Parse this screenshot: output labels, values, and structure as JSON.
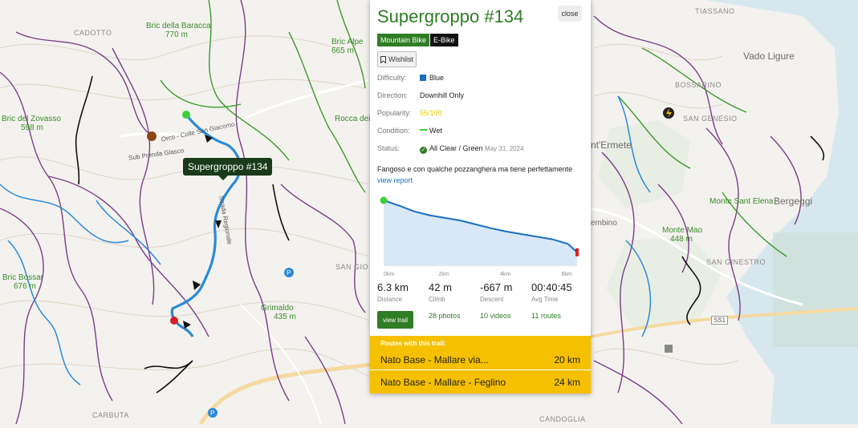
{
  "map": {
    "peaks": [
      {
        "name": "Bric della Baracca",
        "elev": "770 m"
      },
      {
        "name": "Bric Alpe",
        "elev": "665 m"
      },
      {
        "name": "Bric del Zovasso",
        "elev": "598 m"
      },
      {
        "name": "Rocca dei",
        "elev": ""
      },
      {
        "name": "Bric Bossar",
        "elev": "676 m"
      },
      {
        "name": "Grimaldo",
        "elev": "435 m"
      },
      {
        "name": "Monte Sant Elena",
        "elev": ""
      },
      {
        "name": "Monte Mao",
        "elev": "448 m"
      }
    ],
    "towns": [
      "CADOTTO",
      "TIASSANO",
      "BOSSARINO",
      "SAN GENESIO",
      "SAN GIO",
      "CARBUTA",
      "CANDOGLIA",
      "SAN GINESTRO"
    ],
    "cities": [
      "Vado Ligure",
      "Bergeggi",
      "nt'Ermete",
      "embino"
    ],
    "roads": [
      "SS1",
      "Orco - Colle San Giacomo",
      "Strada Regionale",
      "Sub Prenda Glasco"
    ],
    "tooltip": "Supergroppo #134"
  },
  "panel": {
    "title": "Supergroppo #134",
    "close_label": "close",
    "tags": [
      "Mountain Bike",
      "E-Bike"
    ],
    "wishlist_label": "Wishlist",
    "rows": [
      {
        "label": "Difficulty:",
        "value": "Blue"
      },
      {
        "label": "Direction:",
        "value": "Downhill Only"
      },
      {
        "label": "Popularity:",
        "value": "55/100"
      },
      {
        "label": "Condition:",
        "value": "Wet"
      },
      {
        "label": "Status:",
        "value": "All Clear / Green",
        "date": "May 31, 2024"
      }
    ],
    "description": "Fangoso e con qualche pozzanghera ma tiene perfettamente",
    "view_report": "view report",
    "chart_data": {
      "type": "area",
      "x_ticks": [
        "0km",
        "2km",
        "4km",
        "6km"
      ],
      "x": [
        0,
        0.5,
        1,
        1.5,
        2,
        2.5,
        3,
        3.5,
        4,
        4.5,
        5,
        5.5,
        6,
        6.3
      ],
      "y": [
        100,
        92,
        83,
        77,
        73,
        69,
        63,
        57,
        52,
        48,
        44,
        40,
        33,
        20
      ],
      "ylabel": "",
      "xlabel": ""
    },
    "stats": [
      {
        "value": "6.3 km",
        "label": "Distance"
      },
      {
        "value": "42 m",
        "label": "Climb"
      },
      {
        "value": "-667 m",
        "label": "Descent"
      },
      {
        "value": "00:40:45",
        "label": "Avg Time"
      }
    ],
    "view_trail_label": "view trail",
    "photos": "28 photos",
    "videos": "10 videos",
    "routes_count": "11 routes",
    "routes_header": "Routes with this trail:",
    "routes": [
      {
        "name": "Nato Base - Mallare via...",
        "dist": "20 km"
      },
      {
        "name": "Nato Base - Mallare - Feglino",
        "dist": "24 km"
      }
    ],
    "colors": {
      "brand": "#2f7d25",
      "blue": "#1a6fc0",
      "popularity": "#e8c600",
      "wet": "#3ad13a",
      "routes_bg": "#f5c000"
    }
  }
}
